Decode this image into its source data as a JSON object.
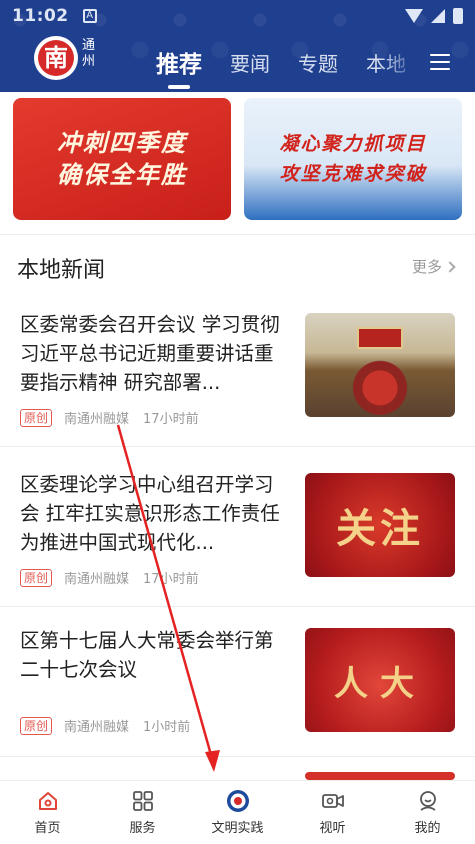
{
  "status_bar": {
    "time": "11:02",
    "notif": "A"
  },
  "header": {
    "logo_char": "南",
    "logo_sub": "通州",
    "tabs": [
      {
        "label": "推荐",
        "active": true
      },
      {
        "label": "要闻",
        "active": false
      },
      {
        "label": "专题",
        "active": false
      },
      {
        "label": "本地",
        "active": false
      }
    ]
  },
  "banners": [
    {
      "lines": [
        "冲刺四季度",
        "确保全年胜"
      ]
    },
    {
      "lines": [
        "凝心聚力抓项目",
        "攻坚克难求突破"
      ]
    }
  ],
  "section": {
    "title": "本地新闻",
    "more": "更多"
  },
  "news": [
    {
      "title": "区委常委会召开会议 学习贯彻习近平总书记近期重要讲话重要指示精神 研究部署...",
      "badge": "原创",
      "source": "南通州融媒",
      "time": "17小时前",
      "thumb": "meeting-photo"
    },
    {
      "title": "区委理论学习中心组召开学习会 扛牢扛实意识形态工作责任 为推进中国式现代化...",
      "badge": "原创",
      "source": "南通州融媒",
      "time": "17小时前",
      "thumb": "关注"
    },
    {
      "title": "区第十七届人大常委会举行第二十七次会议",
      "badge": "原创",
      "source": "南通州融媒",
      "time": "1小时前",
      "thumb": "人大"
    }
  ],
  "bottom_nav": [
    {
      "label": "首页",
      "icon": "home-icon",
      "active": true
    },
    {
      "label": "服务",
      "icon": "grid-icon",
      "active": false
    },
    {
      "label": "文明实践",
      "icon": "emblem-icon",
      "active": false
    },
    {
      "label": "视听",
      "icon": "video-icon",
      "active": false
    },
    {
      "label": "我的",
      "icon": "profile-icon",
      "active": false
    }
  ],
  "colors": {
    "header": "#1f3f8f",
    "accent": "#d62a2a",
    "badge": "#e25a50"
  }
}
